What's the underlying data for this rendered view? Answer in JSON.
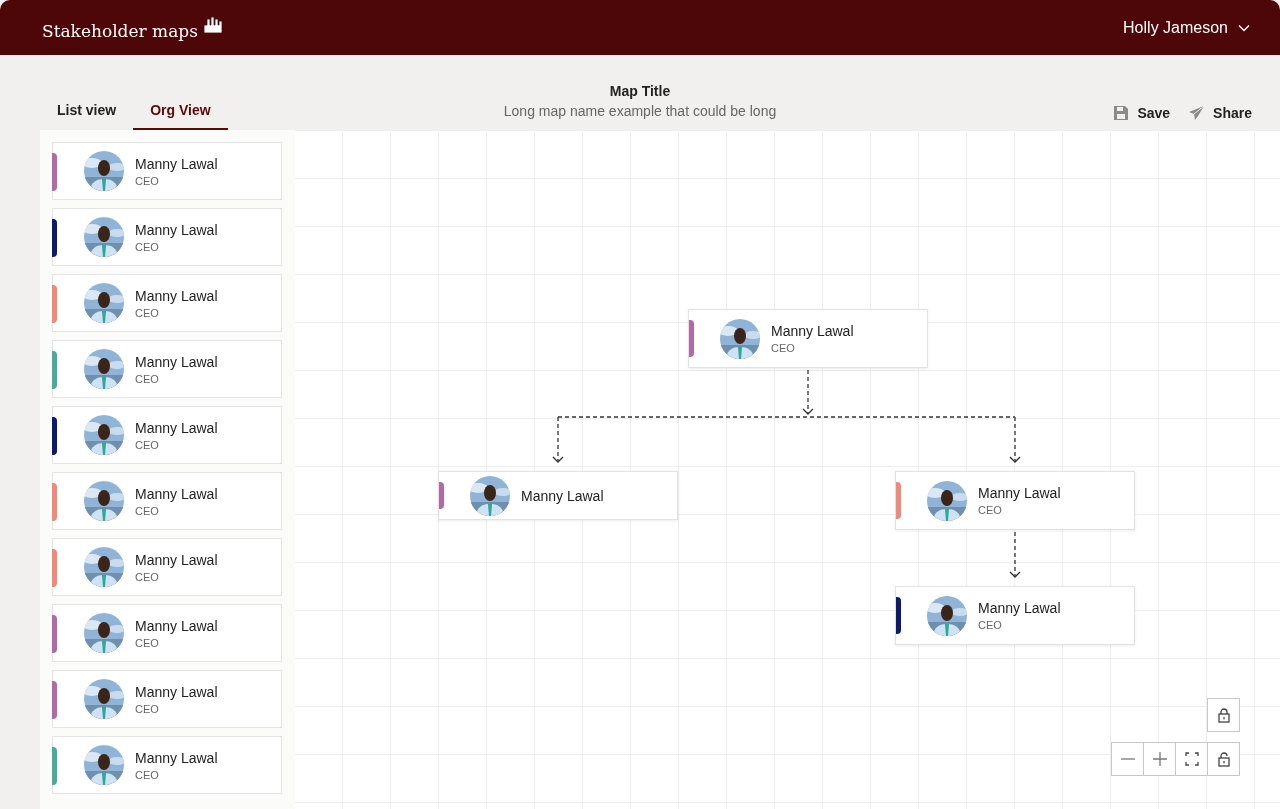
{
  "header": {
    "app_title": "Stakeholder maps",
    "user_name": "Holly Jameson"
  },
  "tabs": [
    {
      "label": "List view",
      "selected": false
    },
    {
      "label": "Org View",
      "selected": true
    }
  ],
  "map": {
    "title": "Map Title",
    "subtitle": "Long map name example that could be long"
  },
  "actions": [
    {
      "kind": "save",
      "label": "Save"
    },
    {
      "kind": "share",
      "label": "Share"
    }
  ],
  "sidebar": {
    "cards": [
      {
        "name": "Manny Lawal",
        "role": "CEO",
        "color": "#b06aa8"
      },
      {
        "name": "Manny Lawal",
        "role": "CEO",
        "color": "#0a1a6e"
      },
      {
        "name": "Manny Lawal",
        "role": "CEO",
        "color": "#f0897a"
      },
      {
        "name": "Manny Lawal",
        "role": "CEO",
        "color": "#4aab98"
      },
      {
        "name": "Manny Lawal",
        "role": "CEO",
        "color": "#0a1a6e"
      },
      {
        "name": "Manny Lawal",
        "role": "CEO",
        "color": "#f0897a"
      },
      {
        "name": "Manny Lawal",
        "role": "CEO",
        "color": "#f0897a"
      },
      {
        "name": "Manny Lawal",
        "role": "CEO",
        "color": "#b06aa8"
      },
      {
        "name": "Manny Lawal",
        "role": "CEO",
        "color": "#b06aa8"
      },
      {
        "name": "Manny Lawal",
        "role": "CEO",
        "color": "#4aab98"
      }
    ]
  },
  "canvas": {
    "root": {
      "name": "Manny Lawal",
      "role": "CEO",
      "color": "#b06aa8",
      "children": [
        {
          "name": "Manny Lawal",
          "color": "#b06aa8"
        },
        {
          "name": "Manny Lawal",
          "role": "CEO",
          "color": "#f0897a",
          "children": [
            {
              "name": "Manny Lawal",
              "role": "CEO",
              "color": "#0a1a6e"
            }
          ]
        }
      ]
    }
  }
}
